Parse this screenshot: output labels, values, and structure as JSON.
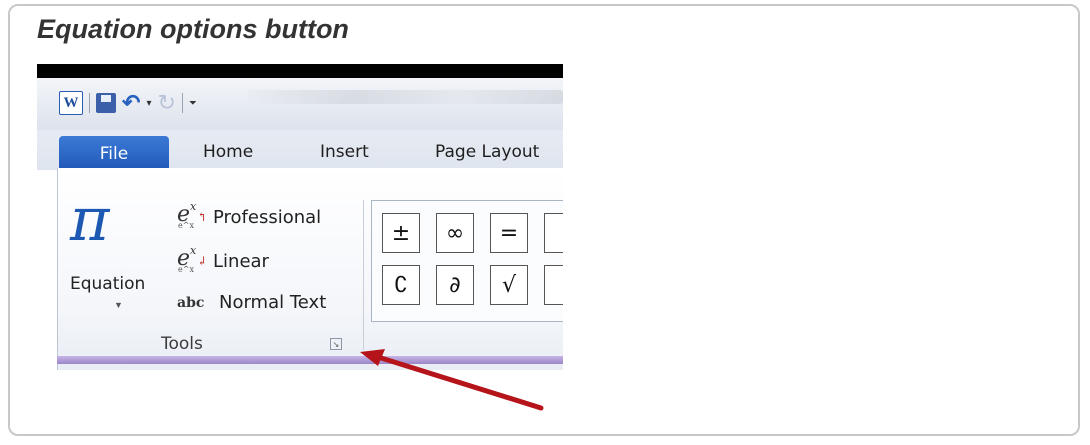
{
  "caption": "Equation options button",
  "window": {
    "quick_access": {
      "app_icon_letter": "W"
    },
    "tabs": {
      "file": "File",
      "home": "Home",
      "insert": "Insert",
      "page_layout": "Page Layout"
    }
  },
  "ribbon": {
    "equation": {
      "label": "Equation"
    },
    "tools": {
      "professional": "Professional",
      "linear": "Linear",
      "normal_text": "Normal Text",
      "normal_text_icon": "abc",
      "group_label": "Tools"
    },
    "symbols": [
      "±",
      "∞",
      "=",
      "∁",
      "∂",
      "√"
    ]
  },
  "colors": {
    "file_tab": "#2862c4",
    "pi": "#1d59b2",
    "arrow": "#b5141a",
    "ribbon_accent": "#9b86c9"
  }
}
